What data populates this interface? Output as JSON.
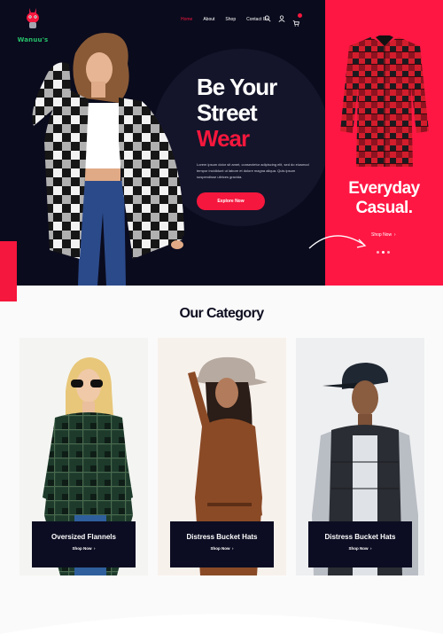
{
  "brand": {
    "name": "Wanuu's"
  },
  "nav": {
    "items": [
      "Home",
      "About",
      "Shop",
      "Contact Us"
    ],
    "active_index": 0,
    "icons": [
      "search-icon",
      "user-icon",
      "cart-icon"
    ]
  },
  "hero": {
    "title_line1": "Be Your",
    "title_line2": "Street",
    "title_line3": "Wear",
    "description": "Lorem ipsum dolor sit amet, consectetur adipiscing elit, sed do eiusmod tempor incididunt ut labore et dolore magna aliqua. Quis ipsum suspendisse ultrices gravida.",
    "button_label": "Explore Now"
  },
  "promo": {
    "title_line1": "Everyday",
    "title_line2": "Casual.",
    "shop_label": "Shop Now",
    "slide_count": 3,
    "active_slide": 2
  },
  "category": {
    "heading": "Our Category",
    "cards": [
      {
        "title": "Oversized Flannels",
        "shop_label": "Shop Now"
      },
      {
        "title": "Distress Bucket Hats",
        "shop_label": "Shop Now"
      },
      {
        "title": "Distress Bucket Hats",
        "shop_label": "Shop Now"
      }
    ]
  },
  "colors": {
    "accent": "#f5173d",
    "dark": "#0a0b1d",
    "panel": "#ff1744"
  }
}
